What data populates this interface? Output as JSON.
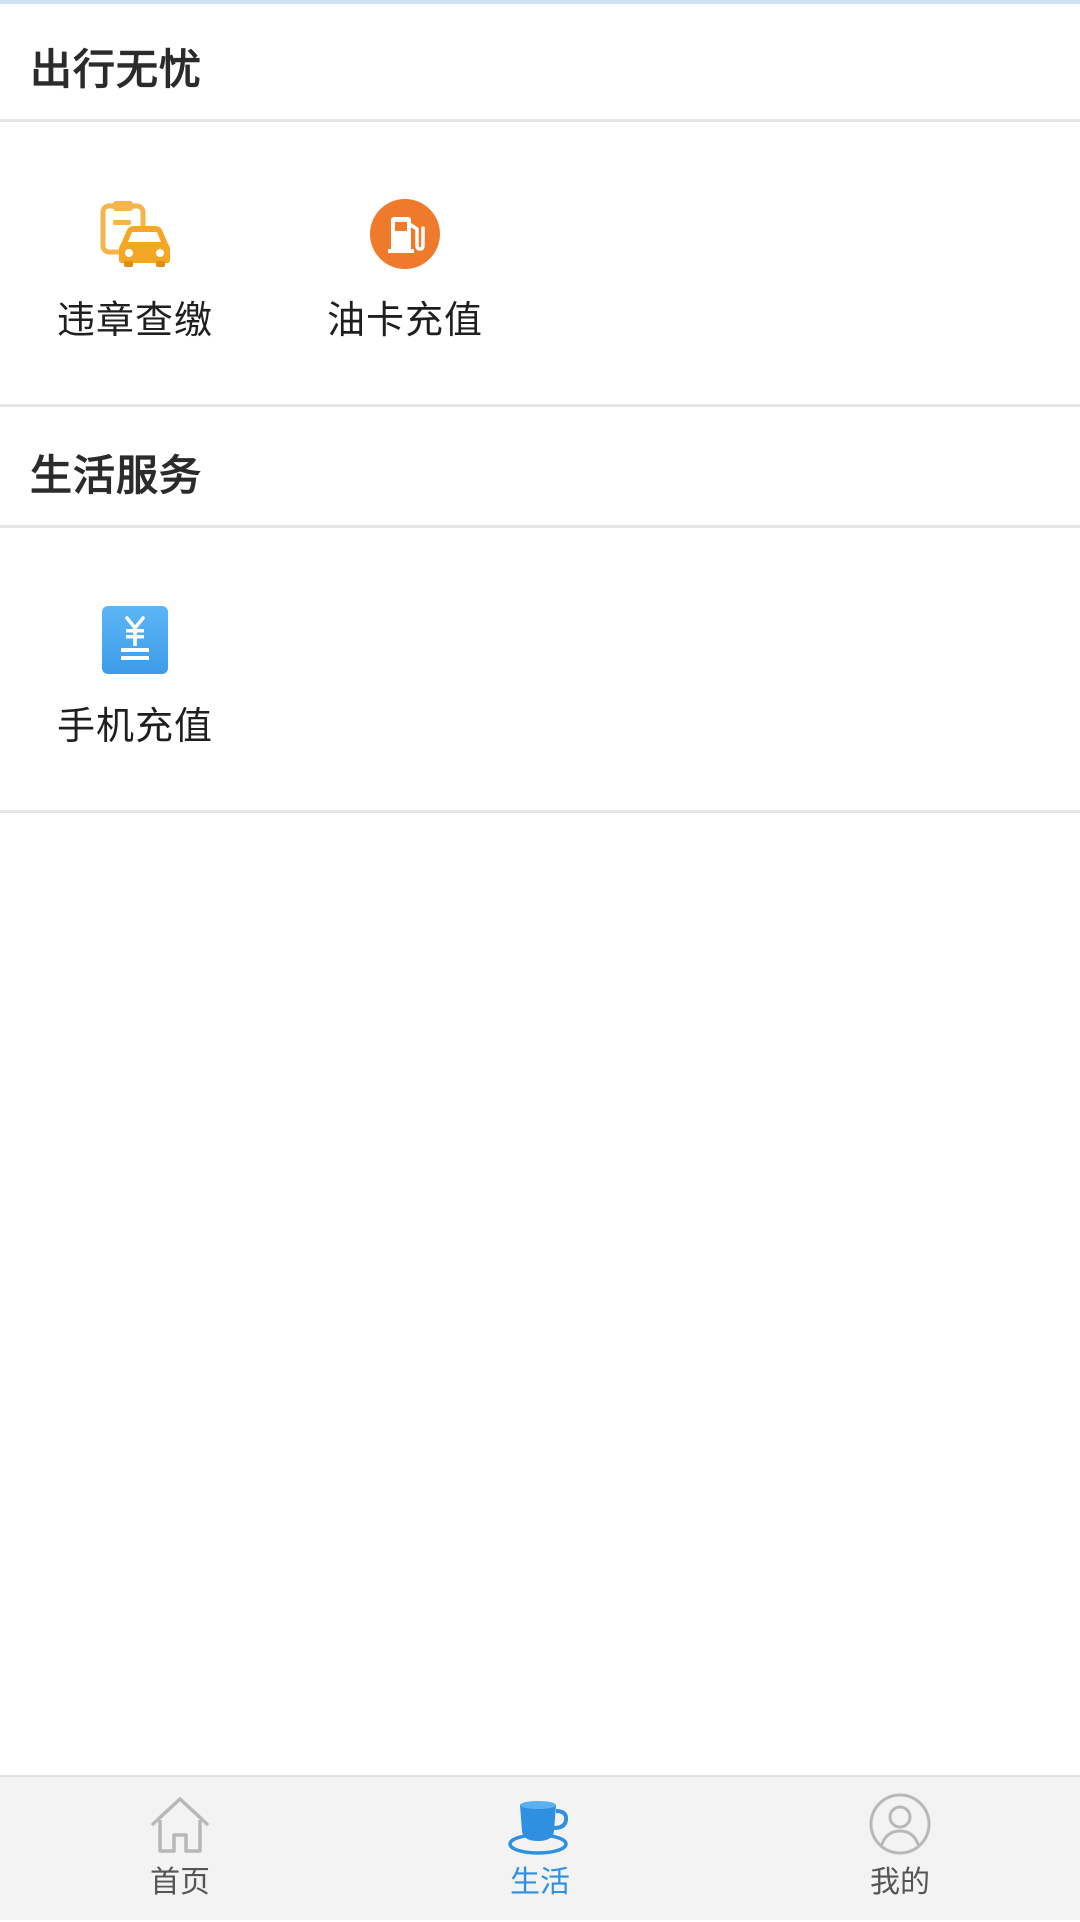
{
  "sections": [
    {
      "title": "出行无忧",
      "items": [
        {
          "label": "违章查缴",
          "icon": "car-violation-icon"
        },
        {
          "label": "油卡充值",
          "icon": "fuel-pump-icon"
        }
      ]
    },
    {
      "title": "生活服务",
      "items": [
        {
          "label": "手机充值",
          "icon": "yuan-recharge-icon"
        }
      ]
    }
  ],
  "tabbar": {
    "active": "生活",
    "tabs": [
      {
        "label": "首页",
        "icon": "home-icon"
      },
      {
        "label": "生活",
        "icon": "coffee-cup-icon"
      },
      {
        "label": "我的",
        "icon": "user-icon"
      }
    ]
  },
  "colors": {
    "accent": "#2f8fe0",
    "fuel": "#ef7a2b",
    "car": "#f5a623",
    "recharge": "#4aa8f0",
    "tab_inactive": "#555555",
    "tabbar_bg": "#f3f3f3"
  }
}
